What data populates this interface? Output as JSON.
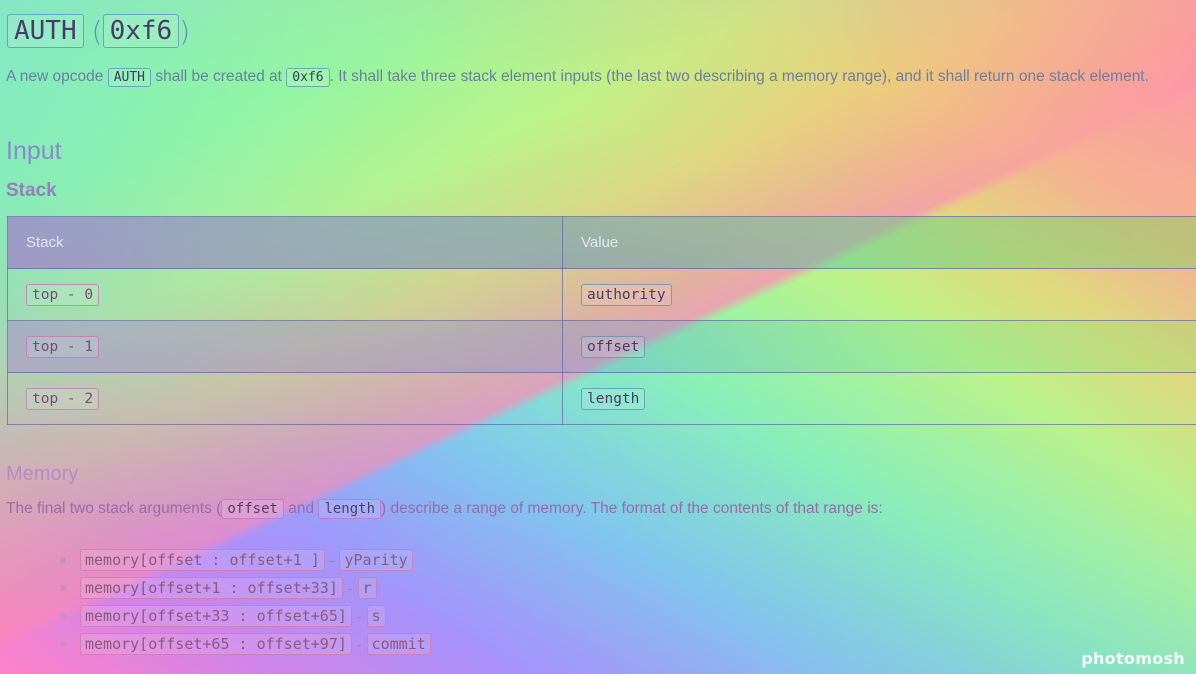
{
  "heading": {
    "opcode_name": "AUTH",
    "opcode_hex": "0xf6",
    "open_paren": "(",
    "close_paren": ")"
  },
  "intro": {
    "part1": "A new opcode ",
    "code1": "AUTH",
    "part2": " shall be created at ",
    "code2": "0xf6",
    "part3": ". It shall take three stack element inputs (the last two describing a memory range), and it shall return one stack element."
  },
  "input_section": {
    "title": "Input",
    "stack_subtitle": "Stack",
    "table": {
      "columns": [
        "Stack",
        "Value"
      ],
      "rows": [
        {
          "stack": "top - 0",
          "value": "authority"
        },
        {
          "stack": "top - 1",
          "value": "offset"
        },
        {
          "stack": "top - 2",
          "value": "length"
        }
      ]
    }
  },
  "memory_section": {
    "title": "Memory",
    "desc_part1": "The final two stack arguments (",
    "desc_code1": "offset",
    "desc_part2": " and ",
    "desc_code2": "length",
    "desc_part3": ") describe a range of memory. The format of the contents of that range is:",
    "separator": "-",
    "items": [
      {
        "range": "memory[offset : offset+1 ]",
        "field": "yParity"
      },
      {
        "range": "memory[offset+1 : offset+33]",
        "field": "r"
      },
      {
        "range": "memory[offset+33 : offset+65]",
        "field": "s"
      },
      {
        "range": "memory[offset+65 : offset+97]",
        "field": "commit"
      }
    ],
    "bullet_icon": "bullet-icon"
  },
  "watermark": "photomosh"
}
